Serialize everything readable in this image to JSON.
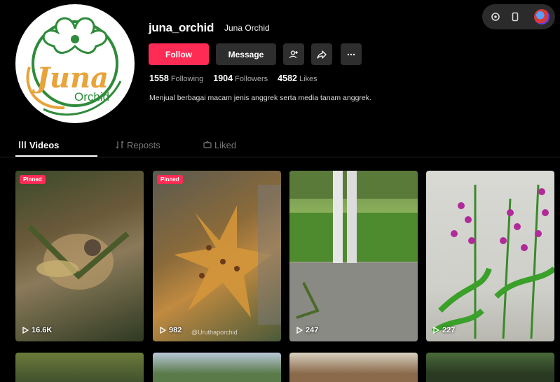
{
  "profile": {
    "username": "juna_orchid",
    "display_name": "Juna Orchid",
    "logo_text_main": "Juna",
    "logo_text_sub": "Orchid",
    "bio": "Menjual berbagai macam jenis anggrek serta media tanam anggrek."
  },
  "actions": {
    "follow_label": "Follow",
    "message_label": "Message",
    "icons": [
      "add-friend-icon",
      "share-icon",
      "more-icon"
    ]
  },
  "stats": {
    "following_count": "1558",
    "following_label": "Following",
    "followers_count": "1904",
    "followers_label": "Followers",
    "likes_count": "4582",
    "likes_label": "Likes"
  },
  "tabs": {
    "videos": "Videos",
    "reposts": "Reposts",
    "liked": "Liked"
  },
  "videos": [
    {
      "badge": "Pinned",
      "views": "16.6K"
    },
    {
      "badge": "Pinned",
      "views": "982",
      "watermark": "@Uruthaporchid"
    },
    {
      "badge": "",
      "views": "247"
    },
    {
      "badge": "",
      "views": "227"
    }
  ],
  "colors": {
    "accent": "#fe2c55",
    "background": "#000000",
    "button_dark": "#2e2e2e"
  }
}
